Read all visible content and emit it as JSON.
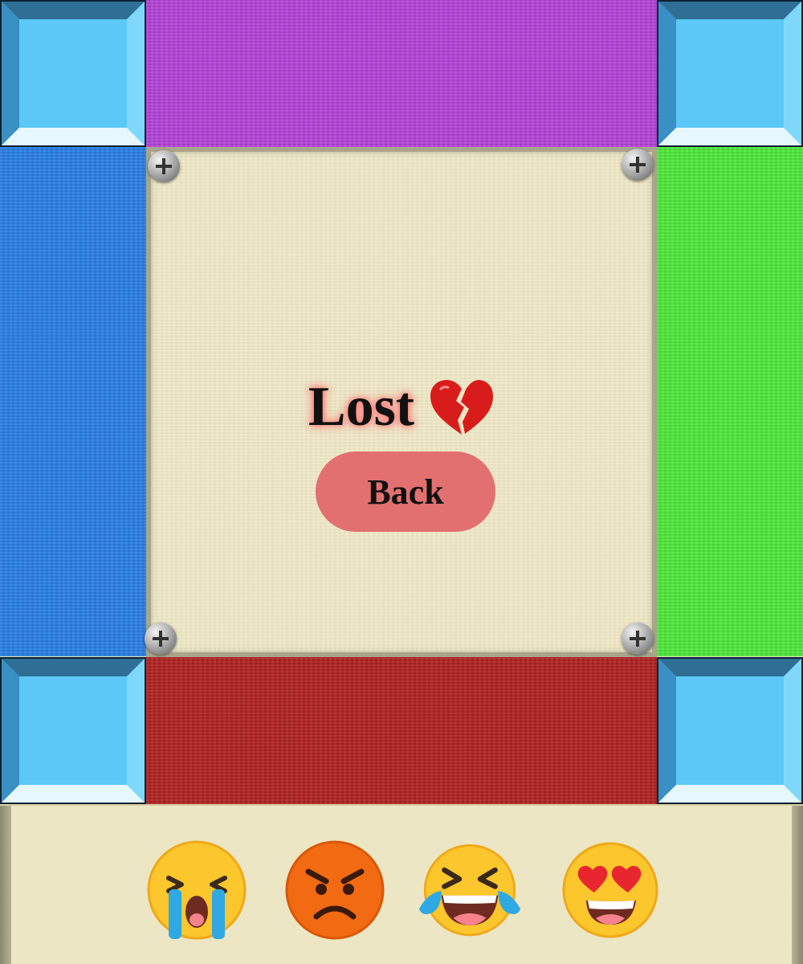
{
  "result": {
    "text": "Lost",
    "icon": "broken-heart-icon"
  },
  "back_button": {
    "label": "Back"
  },
  "emojis": [
    {
      "name": "crying-face-icon"
    },
    {
      "name": "angry-face-icon"
    },
    {
      "name": "laughing-tears-face-icon"
    },
    {
      "name": "heart-eyes-face-icon"
    }
  ],
  "colors": {
    "top_panel": "#b344d8",
    "left_panel": "#2a7fe6",
    "right_panel": "#4fe83a",
    "bottom_panel": "#b02222",
    "corner_tile": "#5bc8f8",
    "board": "#efe9c7",
    "back_button": "#e37070"
  }
}
